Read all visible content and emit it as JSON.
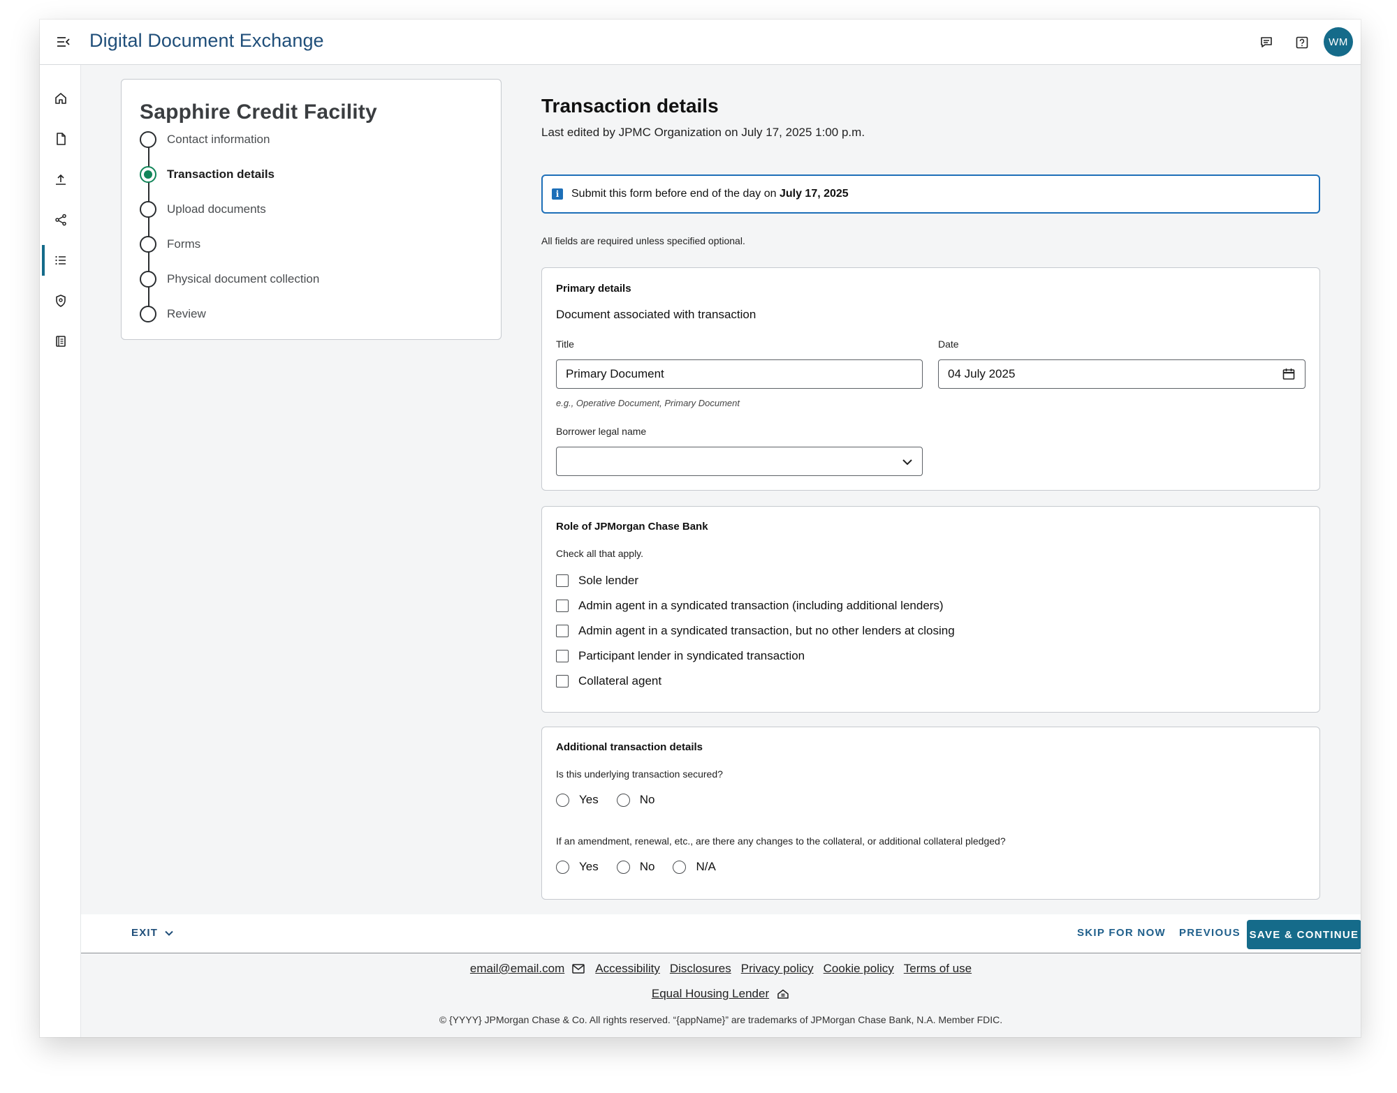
{
  "header": {
    "app_title": "Digital Document Exchange",
    "avatar_initials": "WM"
  },
  "sidebar": {
    "items": [
      {
        "icon": "home-icon"
      },
      {
        "icon": "document-icon"
      },
      {
        "icon": "upload-icon"
      },
      {
        "icon": "share-icon"
      },
      {
        "icon": "list-icon",
        "active": true
      },
      {
        "icon": "shield-icon"
      },
      {
        "icon": "ledger-icon"
      }
    ]
  },
  "stepper": {
    "title": "Sapphire Credit Facility",
    "steps": [
      {
        "label": "Contact information"
      },
      {
        "label": "Transaction details",
        "current": true
      },
      {
        "label": "Upload documents"
      },
      {
        "label": "Forms"
      },
      {
        "label": "Physical document collection"
      },
      {
        "label": "Review"
      }
    ]
  },
  "main": {
    "title": "Transaction details",
    "last_edited": "Last edited by JPMC Organization on July 17, 2025 1:00 p.m.",
    "banner": {
      "text": "Submit this form before end of the day on ",
      "date": "July 17, 2025"
    },
    "required_note": "All fields are required unless specified optional."
  },
  "primary_details": {
    "heading": "Primary details",
    "subheading": "Document associated with transaction",
    "title_label": "Title",
    "title_value": "Primary Document",
    "title_helper": "e.g., Operative Document, Primary Document",
    "date_label": "Date",
    "date_value": "04 July 2025",
    "borrower_label": "Borrower legal name",
    "borrower_value": ""
  },
  "role": {
    "heading": "Role of JPMorgan Chase Bank",
    "instruction": "Check all that apply.",
    "options": [
      "Sole lender",
      "Admin agent in a syndicated transaction (including additional lenders)",
      "Admin agent in a syndicated transaction, but no other lenders at closing",
      "Participant lender in syndicated transaction",
      "Collateral agent"
    ]
  },
  "additional": {
    "heading": "Additional transaction details",
    "q1": "Is this underlying transaction secured?",
    "q1_options": [
      "Yes",
      "No"
    ],
    "q2": "If an amendment, renewal, etc., are there any changes to the collateral, or additional collateral pledged?",
    "q2_options": [
      "Yes",
      "No",
      "N/A"
    ]
  },
  "actions": {
    "exit": "EXIT",
    "skip": "SKIP FOR NOW",
    "previous": "PREVIOUS",
    "save": "SAVE & CONTINUE"
  },
  "footer": {
    "email": "email@email.com",
    "links": [
      "Accessibility",
      "Disclosures",
      "Privacy policy",
      "Cookie policy",
      "Terms of use"
    ],
    "equal_housing": "Equal Housing Lender",
    "copyright": "© {YYYY} JPMorgan Chase & Co. All rights reserved. “{appName}” are trademarks of JPMorgan Chase Bank, N.A. Member FDIC."
  },
  "colors": {
    "brand": "#156b8a",
    "title_blue": "#1f4e79",
    "info_blue": "#1d6fb8",
    "step_green": "#128559"
  }
}
